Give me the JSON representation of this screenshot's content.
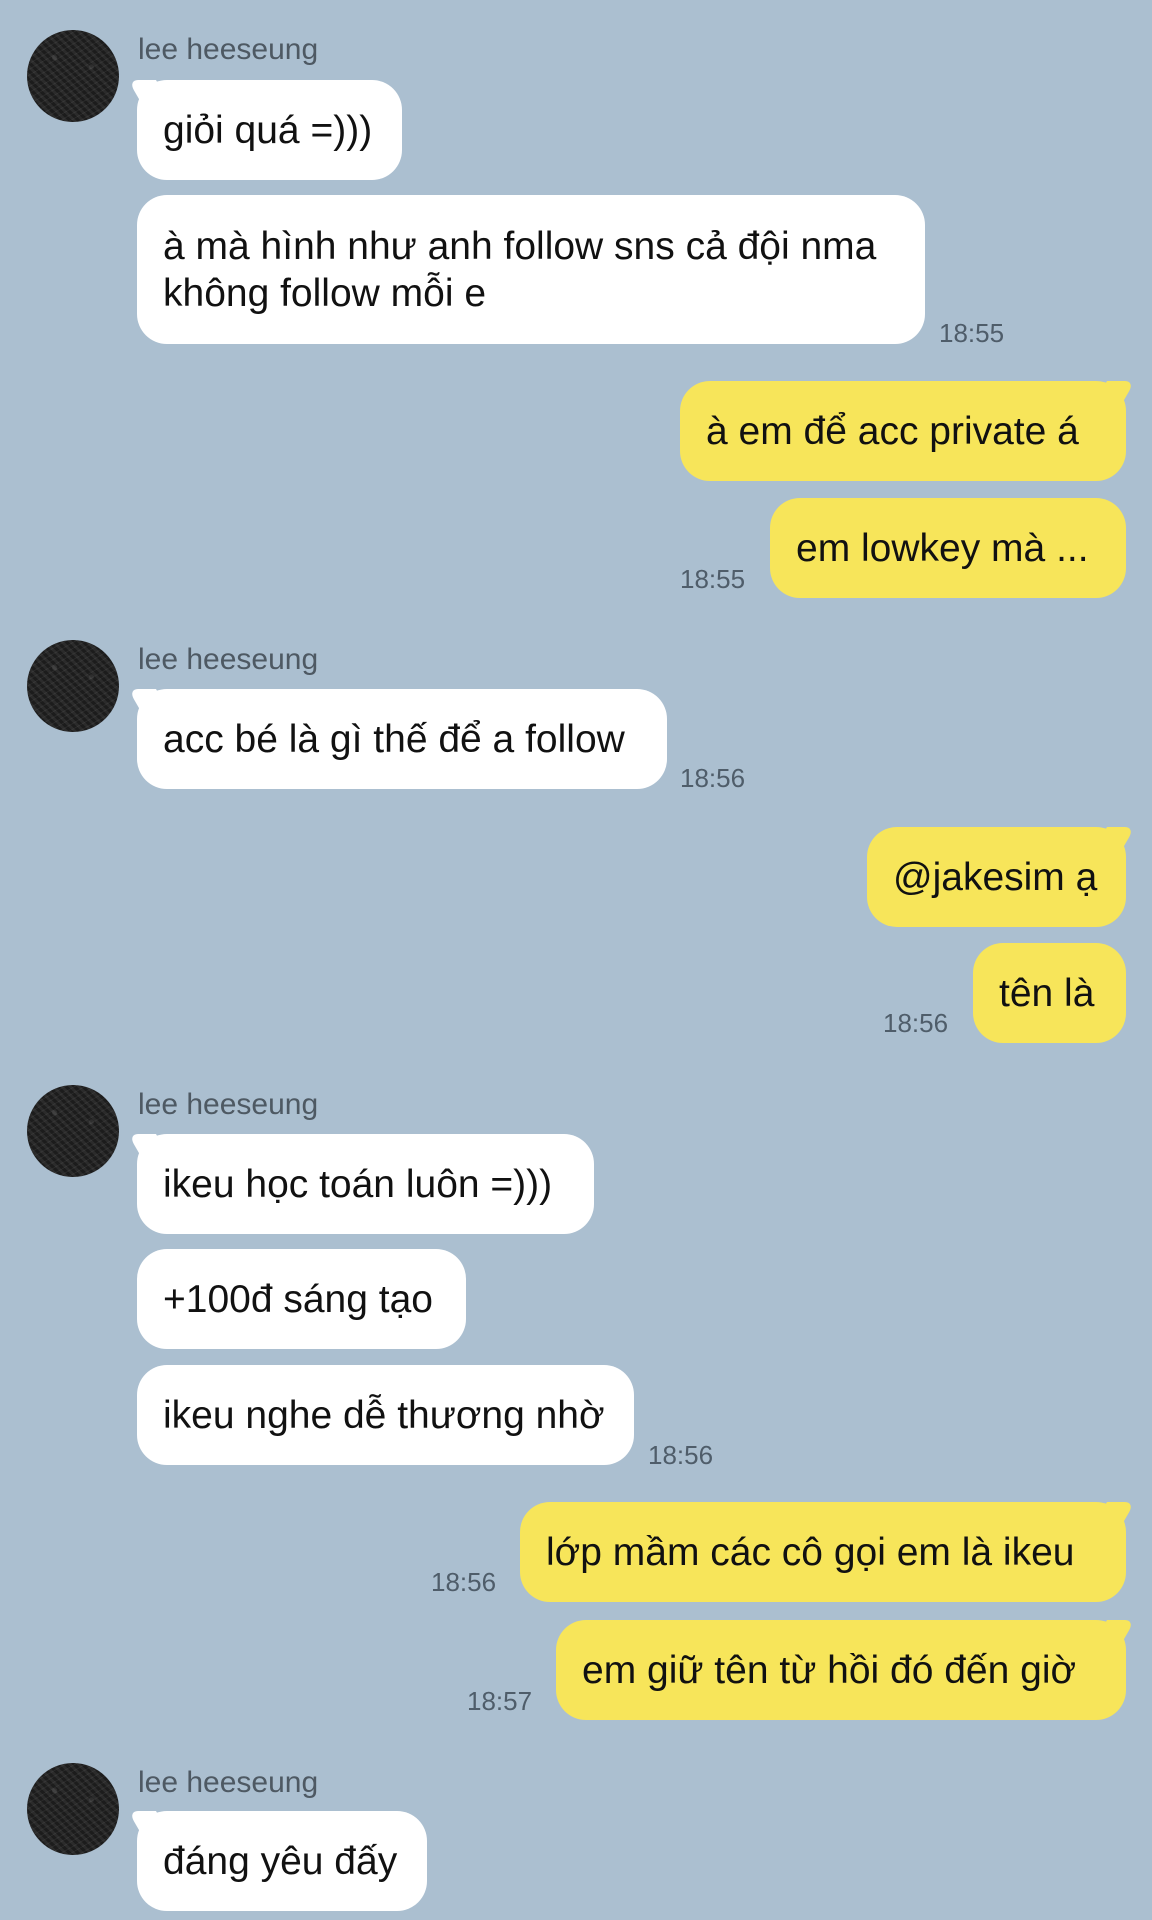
{
  "contact": {
    "name": "lee heeseung"
  },
  "messages": {
    "g1": {
      "sender": "lee heeseung",
      "m1": "giỏi quá =)))",
      "m2": "à mà hình như anh follow sns cả đội nma không follow mỗi e",
      "time": "18:55"
    },
    "g2": {
      "m1": "à em để acc private á",
      "m2": "em lowkey mà ...",
      "time": "18:55"
    },
    "g3": {
      "sender": "lee heeseung",
      "m1": "acc bé là gì thế để a follow",
      "time": "18:56"
    },
    "g4": {
      "m1": "@jakesim ạ",
      "m2": "tên là",
      "time": "18:56"
    },
    "g5": {
      "sender": "lee heeseung",
      "m1": "ikeu học toán luôn =)))",
      "m2": "+100đ sáng tạo",
      "m3": "ikeu nghe dễ thương nhờ",
      "time": "18:56"
    },
    "g6": {
      "m1": "lớp mầm các cô gọi em là ikeu",
      "time1": "18:56",
      "m2": "em giữ tên từ hồi đó đến giờ",
      "time2": "18:57"
    },
    "g7": {
      "sender": "lee heeseung",
      "m1": "đáng yêu đấy"
    }
  }
}
